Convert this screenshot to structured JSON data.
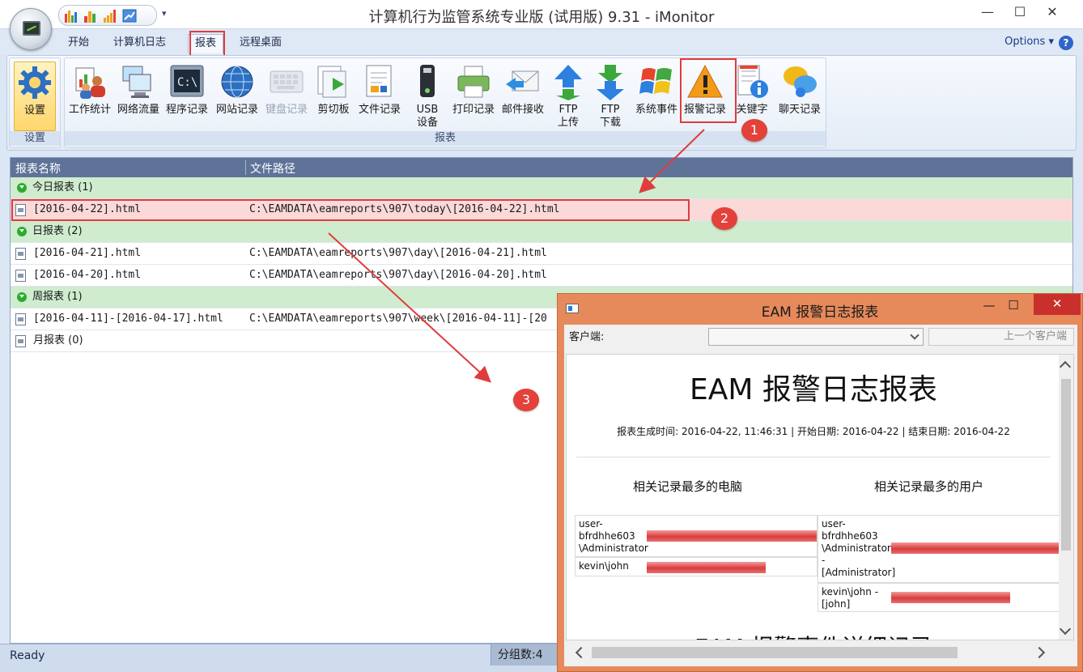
{
  "window": {
    "title": "计算机行为监管系统专业版 (试用版) 9.31 - iMonitor",
    "minimize": "—",
    "maximize": "☐",
    "close": "✕"
  },
  "tabs": [
    {
      "label": "开始"
    },
    {
      "label": "计算机日志"
    },
    {
      "label": "报表"
    },
    {
      "label": "远程桌面"
    }
  ],
  "options_label": "Options",
  "help_label": "?",
  "ribbon": {
    "settings_group": {
      "button": "设置",
      "label": "设置"
    },
    "reports_group_label": "报表",
    "buttons": [
      {
        "label": "工作统计",
        "icon": "work-stats-icon"
      },
      {
        "label": "网络流量",
        "icon": "network-traffic-icon"
      },
      {
        "label": "程序记录",
        "icon": "program-log-icon"
      },
      {
        "label": "网站记录",
        "icon": "website-log-icon"
      },
      {
        "label": "键盘记录",
        "icon": "keyboard-log-icon"
      },
      {
        "label": "剪切板",
        "icon": "clipboard-icon"
      },
      {
        "label": "文件记录",
        "icon": "file-log-icon"
      },
      {
        "label": "USB",
        "label2": "设备",
        "icon": "usb-device-icon"
      },
      {
        "label": "打印记录",
        "icon": "print-log-icon"
      },
      {
        "label": "邮件接收",
        "icon": "mail-receive-icon"
      },
      {
        "label": "FTP",
        "label2": "上传",
        "icon": "ftp-upload-icon"
      },
      {
        "label": "FTP",
        "label2": "下载",
        "icon": "ftp-download-icon"
      },
      {
        "label": "系统事件",
        "icon": "system-events-icon"
      },
      {
        "label": "报警记录",
        "icon": "alert-log-icon"
      },
      {
        "label": "关键字",
        "icon": "keyword-icon"
      },
      {
        "label": "聊天记录",
        "icon": "chat-log-icon"
      }
    ]
  },
  "list": {
    "columns": [
      "报表名称",
      "文件路径"
    ],
    "rows": [
      {
        "type": "group",
        "name": "今日报表 (1)"
      },
      {
        "type": "file",
        "name": "[2016-04-22].html",
        "path": "C:\\EAMDATA\\eamreports\\907\\today\\[2016-04-22].html"
      },
      {
        "type": "group",
        "name": "日报表 (2)"
      },
      {
        "type": "file",
        "name": "[2016-04-21].html",
        "path": "C:\\EAMDATA\\eamreports\\907\\day\\[2016-04-21].html"
      },
      {
        "type": "file",
        "name": "[2016-04-20].html",
        "path": "C:\\EAMDATA\\eamreports\\907\\day\\[2016-04-20].html"
      },
      {
        "type": "group",
        "name": "周报表 (1)"
      },
      {
        "type": "file",
        "name": "[2016-04-11]-[2016-04-17].html",
        "path": "C:\\EAMDATA\\eamreports\\907\\week\\[2016-04-11]-[20"
      },
      {
        "type": "file",
        "name": "月报表 (0)",
        "path": ""
      }
    ]
  },
  "annotations": [
    "1",
    "2",
    "3"
  ],
  "status": {
    "ready": "Ready",
    "groups": "分组数:4"
  },
  "popup": {
    "title": "EAM 报警日志报表",
    "minimize": "—",
    "maximize": "☐",
    "close": "✕",
    "client_label": "客户端:",
    "prev_button": "上一个客户端",
    "doc_title": "EAM 报警日志报表",
    "doc_meta": "报表生成时间: 2016-04-22, 11:46:31 | 开始日期: 2016-04-22 | 结束日期: 2016-04-22",
    "computers_heading": "相关记录最多的电脑",
    "users_heading": "相关记录最多的用户",
    "computers": [
      {
        "name": "user-\nbfrdhhe603\n\\Administrator",
        "value": 1.0
      },
      {
        "name": "kevin\\john",
        "value": 0.7
      }
    ],
    "users": [
      {
        "name": "user-\nbfrdhhe603\n\\Administrator\n-\n[Administrator]",
        "value": 1.0
      },
      {
        "name": "kevin\\john -\n[john]",
        "value": 0.7
      }
    ],
    "detail_heading": "EAM 报警事件详细记录"
  }
}
